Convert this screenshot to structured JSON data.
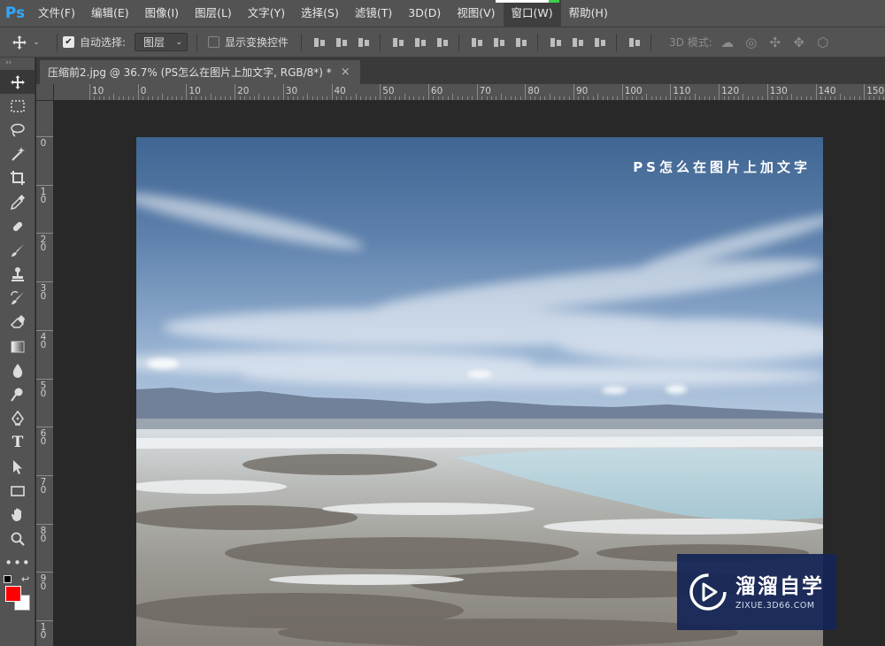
{
  "app": {
    "logo": "Ps"
  },
  "menu": [
    "文件(F)",
    "编辑(E)",
    "图像(I)",
    "图层(L)",
    "文字(Y)",
    "选择(S)",
    "滤镜(T)",
    "3D(D)",
    "视图(V)",
    "窗口(W)",
    "帮助(H)"
  ],
  "options": {
    "auto_select_label": "自动选择:",
    "auto_select_checked": true,
    "auto_select_target": "图层",
    "show_transform_label": "显示变换控件",
    "show_transform_checked": false,
    "mode_3d_label": "3D 模式:"
  },
  "tab": {
    "title": "压缩前2.jpg @ 36.7% (PS怎么在图片上加文字, RGB/8*) *",
    "close": "×"
  },
  "ruler_top": [
    "10",
    "0",
    "10",
    "20",
    "30",
    "40",
    "50",
    "60",
    "70",
    "80",
    "90",
    "100",
    "110",
    "120",
    "130",
    "140",
    "150"
  ],
  "ruler_left": [
    "0",
    "1\n0",
    "2\n0",
    "3\n0",
    "4\n0",
    "5\n0",
    "6\n0",
    "7\n0",
    "8\n0",
    "9\n0",
    "1\n0"
  ],
  "tools": [
    {
      "name": "move-tool",
      "selected": true
    },
    {
      "name": "marquee-tool",
      "selected": false
    },
    {
      "name": "lasso-tool",
      "selected": false
    },
    {
      "name": "magic-wand-tool",
      "selected": false
    },
    {
      "name": "crop-tool",
      "selected": false
    },
    {
      "name": "eyedropper-tool",
      "selected": false
    },
    {
      "name": "healing-brush-tool",
      "selected": false
    },
    {
      "name": "brush-tool",
      "selected": false
    },
    {
      "name": "clone-stamp-tool",
      "selected": false
    },
    {
      "name": "history-brush-tool",
      "selected": false
    },
    {
      "name": "eraser-tool",
      "selected": false
    },
    {
      "name": "gradient-tool",
      "selected": false
    },
    {
      "name": "blur-tool",
      "selected": false
    },
    {
      "name": "dodge-tool",
      "selected": false
    },
    {
      "name": "pen-tool",
      "selected": false
    },
    {
      "name": "type-tool",
      "selected": false
    },
    {
      "name": "path-selection-tool",
      "selected": false
    },
    {
      "name": "rectangle-tool",
      "selected": false
    },
    {
      "name": "hand-tool",
      "selected": false
    },
    {
      "name": "zoom-tool",
      "selected": false
    },
    {
      "name": "more-tools",
      "selected": false
    }
  ],
  "colors": {
    "foreground": "#ff0000",
    "background": "#ffffff",
    "accent": "#31a8ff"
  },
  "canvas": {
    "caption": "PS怎么在图片上加文字"
  },
  "watermark": {
    "title": "溜溜自学",
    "subtitle": "ZIXUE.3D66.COM"
  }
}
